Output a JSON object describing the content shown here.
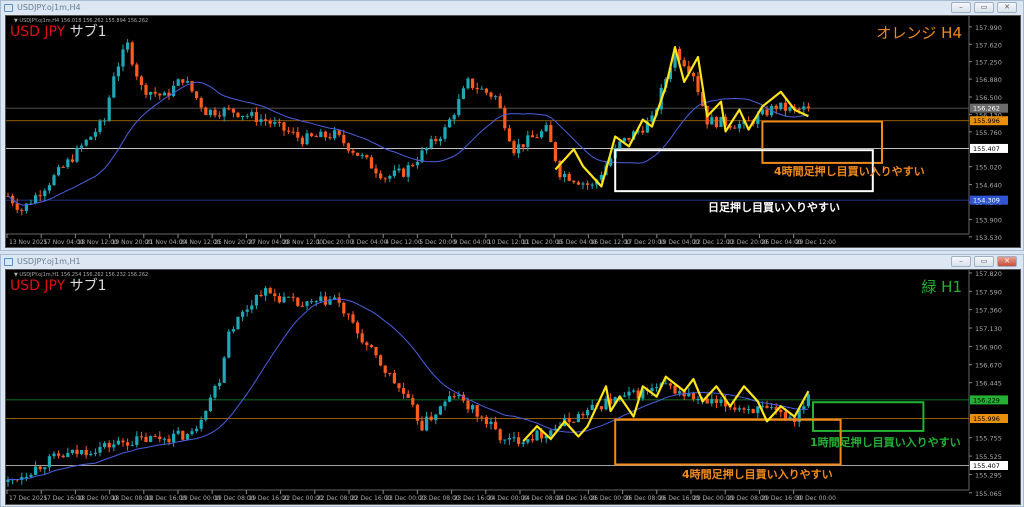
{
  "top": {
    "window_title": "USDJPY.oj1m,H4",
    "info_line": "▼ USDJPY.oj1m,H4  156.018 156.262 155.894 156.262",
    "symbol": "USD JPY",
    "sub_label": "サブ1",
    "timeframe_label": "オレンジ H4",
    "price_range": [
      153.59,
      158.22
    ],
    "price_ticks": [
      "157.990",
      "157.620",
      "157.250",
      "156.880",
      "156.500",
      "156.130",
      "155.760",
      "155.020",
      "154.640",
      "154.270",
      "153.900",
      "153.530"
    ],
    "levels": [
      {
        "price": 156.262,
        "label": "156.262",
        "color": "#6c6c6c",
        "text": "#fff"
      },
      {
        "price": 155.996,
        "label": "155.996",
        "color": "#e8900c",
        "text": "#000"
      },
      {
        "price": 155.407,
        "label": "155.407",
        "color": "#ffffff",
        "text": "#000"
      },
      {
        "price": 154.309,
        "label": "154.309",
        "color": "#2f55d4",
        "text": "#fff"
      }
    ],
    "time_labels": [
      "13 Nov 2025",
      "17 Nov 04:00",
      "18 Nov 12:00",
      "19 Nov 20:00",
      "21 Nov 04:00",
      "24 Nov 12:00",
      "25 Nov 20:00",
      "27 Nov 04:00",
      "28 Nov 12:00",
      "1 Dec 20:00",
      "3 Dec 04:00",
      "4 Dec 12:00",
      "5 Dec 20:00",
      "9 Dec 04:00",
      "10 Dec 12:00",
      "11 Dec 20:00",
      "15 Dec 04:00",
      "16 Dec 12:00",
      "17 Dec 20:00",
      "19 Dec 04:00",
      "22 Dec 12:00",
      "23 Dec 20:00",
      "26 Dec 04:00",
      "29 Dec 12:00"
    ],
    "keypoints": [
      [
        0,
        154.4
      ],
      [
        3,
        154.1
      ],
      [
        12,
        155.0
      ],
      [
        21,
        156.0
      ],
      [
        23,
        157.0
      ],
      [
        26,
        157.6
      ],
      [
        29,
        156.7
      ],
      [
        34,
        156.5
      ],
      [
        38,
        156.9
      ],
      [
        43,
        156.2
      ],
      [
        49,
        156.2
      ],
      [
        56,
        156.0
      ],
      [
        64,
        155.6
      ],
      [
        71,
        155.7
      ],
      [
        82,
        154.8
      ],
      [
        86,
        154.9
      ],
      [
        95,
        155.8
      ],
      [
        100,
        156.8
      ],
      [
        106,
        156.5
      ],
      [
        110,
        155.4
      ],
      [
        117,
        155.8
      ],
      [
        120,
        154.9
      ],
      [
        127,
        154.6
      ],
      [
        133,
        155.5
      ],
      [
        140,
        156.0
      ],
      [
        145,
        157.5
      ],
      [
        149,
        157.0
      ],
      [
        152,
        156.0
      ],
      [
        160,
        155.9
      ],
      [
        167,
        156.3
      ],
      [
        171,
        156.2
      ],
      [
        174,
        156.26
      ]
    ],
    "zigzag": [
      [
        119,
        154.96
      ],
      [
        123,
        155.39
      ],
      [
        125,
        155.03
      ],
      [
        129,
        154.6
      ],
      [
        132,
        155.66
      ],
      [
        135,
        155.45
      ],
      [
        138,
        156.02
      ],
      [
        140,
        155.87
      ],
      [
        143,
        156.72
      ],
      [
        145,
        157.56
      ],
      [
        147,
        156.82
      ],
      [
        150,
        157.35
      ],
      [
        152,
        156.09
      ],
      [
        155,
        156.4
      ],
      [
        156,
        155.77
      ],
      [
        159,
        156.23
      ],
      [
        161,
        155.81
      ],
      [
        164,
        156.3
      ],
      [
        168,
        156.61
      ],
      [
        171,
        156.23
      ],
      [
        174,
        156.09
      ]
    ],
    "boxes": [
      {
        "idx": [
          164,
          190
        ],
        "price": [
          155.98,
          155.1
        ],
        "color": "#f08a1c"
      },
      {
        "idx": [
          132,
          188
        ],
        "price": [
          155.37,
          154.5
        ],
        "color": "#ffffff"
      }
    ],
    "notes": [
      {
        "text": "4時間足押し目買い入りやすい",
        "color": "#f08a1c"
      },
      {
        "text": "日足押し目買い入りやすい",
        "color": "#ffffff"
      }
    ]
  },
  "bottom": {
    "window_title": "USDJPY.oj1m,H1",
    "info_line": "▼ USDJPY.oj1m,H1  156.254 156.262 156.232 156.262",
    "symbol": "USD JPY",
    "sub_label": "サブ1",
    "timeframe_label": "緑 H1",
    "price_range": [
      155.1,
      157.857
    ],
    "price_ticks": [
      "157.820",
      "157.590",
      "157.360",
      "157.130",
      "156.900",
      "156.670",
      "156.445",
      "155.755",
      "155.525",
      "155.295",
      "155.065"
    ],
    "levels": [
      {
        "price": 156.229,
        "label": "156.229",
        "color": "#23b035",
        "text": "#000"
      },
      {
        "price": 155.996,
        "label": "155.996",
        "color": "#e8900c",
        "text": "#000"
      },
      {
        "price": 155.407,
        "label": "155.407",
        "color": "#ffffff",
        "text": "#000"
      }
    ],
    "time_labels": [
      "17 Dec 2025",
      "17 Dec 16:00",
      "18 Dec 00:00",
      "18 Dec 08:00",
      "18 Dec 16:00",
      "19 Dec 00:00",
      "19 Dec 08:00",
      "19 Dec 16:00",
      "22 Dec 00:00",
      "22 Dec 08:00",
      "22 Dec 16:00",
      "23 Dec 00:00",
      "23 Dec 08:00",
      "23 Dec 16:00",
      "24 Dec 00:00",
      "24 Dec 08:00",
      "24 Dec 16:00",
      "26 Dec 00:00",
      "26 Dec 08:00",
      "26 Dec 16:00",
      "29 Dec 00:00",
      "29 Dec 08:00",
      "29 Dec 16:00",
      "30 Dec 00:00"
    ],
    "keypoints": [
      [
        0,
        155.2
      ],
      [
        10,
        155.5
      ],
      [
        25,
        155.7
      ],
      [
        40,
        155.8
      ],
      [
        46,
        156.5
      ],
      [
        48,
        157.1
      ],
      [
        55,
        157.6
      ],
      [
        64,
        157.4
      ],
      [
        71,
        157.5
      ],
      [
        78,
        156.9
      ],
      [
        86,
        156.3
      ],
      [
        90,
        155.9
      ],
      [
        97,
        156.3
      ],
      [
        105,
        155.9
      ],
      [
        108,
        155.7
      ],
      [
        116,
        155.8
      ],
      [
        130,
        156.2
      ],
      [
        143,
        156.4
      ],
      [
        151,
        156.2
      ],
      [
        164,
        156.1
      ],
      [
        171,
        156.0
      ],
      [
        174,
        156.3
      ]
    ],
    "zigzag": [
      [
        112,
        155.71
      ],
      [
        115,
        155.9
      ],
      [
        118,
        155.74
      ],
      [
        121,
        155.96
      ],
      [
        124,
        155.77
      ],
      [
        126,
        155.9
      ],
      [
        130,
        156.4
      ],
      [
        131,
        156.09
      ],
      [
        133,
        156.27
      ],
      [
        136,
        156.02
      ],
      [
        138,
        156.4
      ],
      [
        141,
        156.27
      ],
      [
        143,
        156.52
      ],
      [
        147,
        156.34
      ],
      [
        149,
        156.49
      ],
      [
        151,
        156.21
      ],
      [
        154,
        156.4
      ],
      [
        157,
        156.15
      ],
      [
        160,
        156.4
      ],
      [
        163,
        156.21
      ],
      [
        165,
        155.96
      ],
      [
        168,
        156.15
      ],
      [
        171,
        156.02
      ],
      [
        174,
        156.34
      ]
    ],
    "boxes": [
      {
        "idx": [
          175,
          199
        ],
        "price": [
          156.2,
          155.84
        ],
        "color": "#23b035"
      },
      {
        "idx": [
          132,
          181
        ],
        "price": [
          155.98,
          155.42
        ],
        "color": "#f08a1c"
      }
    ],
    "notes": [
      {
        "text": "1時間足押し目買い入りやすい",
        "color": "#23b035"
      },
      {
        "text": "4時間足押し目買い入りやすい",
        "color": "#f08a1c"
      }
    ]
  },
  "colors": {
    "up": "#1ea7b4",
    "down": "#ff5a1f",
    "ma": "#4a5fe0",
    "zigzag": "#ffe51a"
  }
}
